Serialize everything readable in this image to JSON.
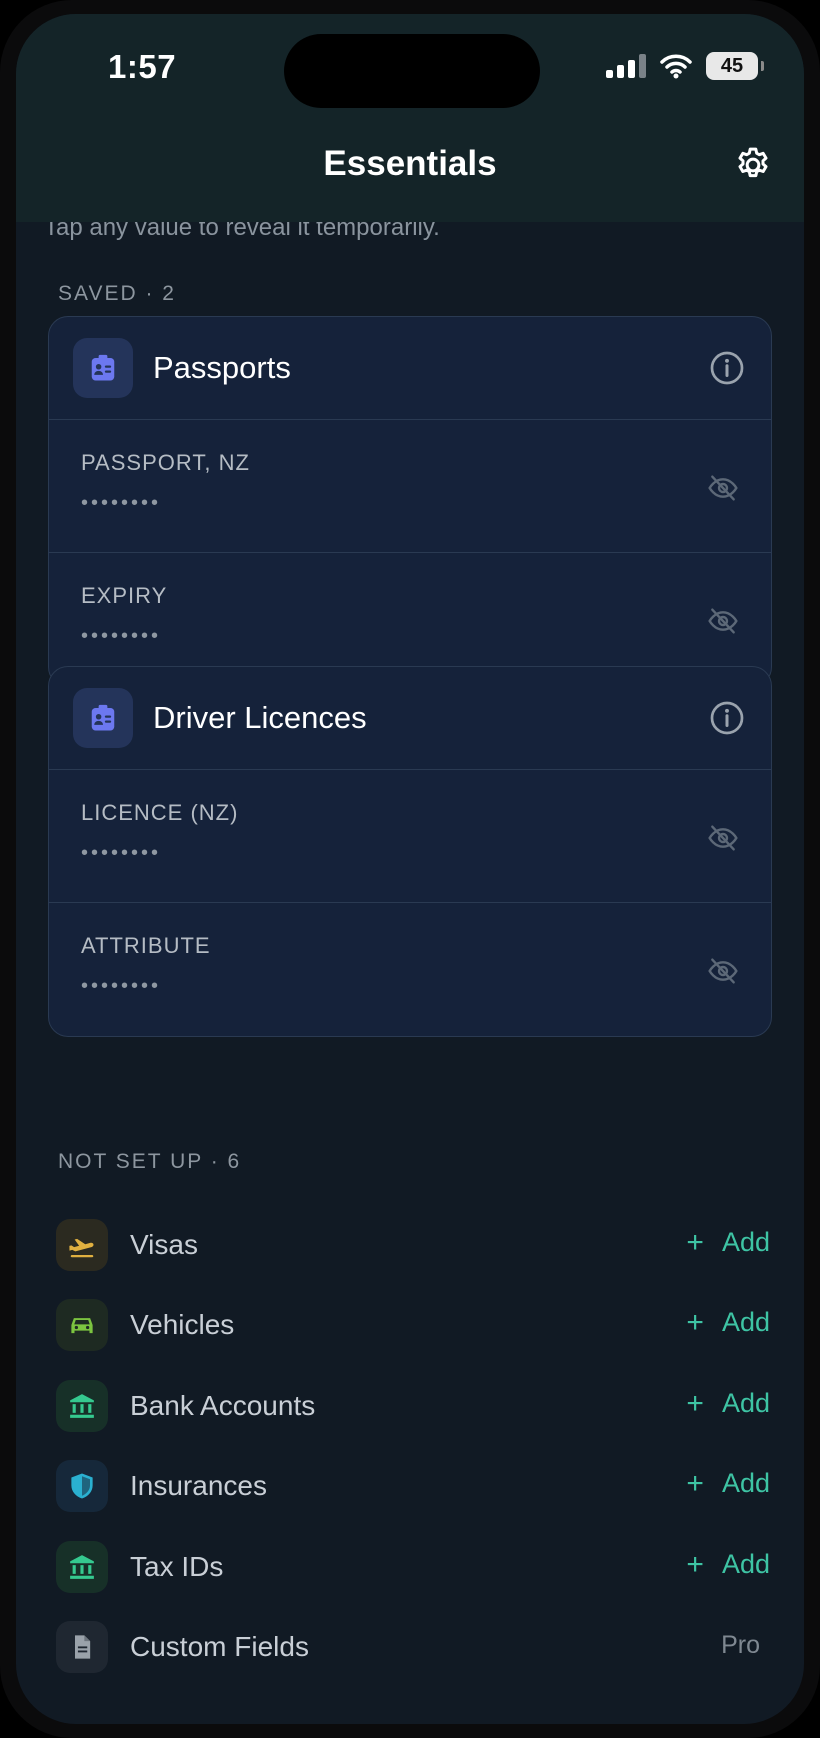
{
  "status_bar": {
    "time": "1:57",
    "battery": "45"
  },
  "header": {
    "title": "Essentials"
  },
  "hint": "Tap any value to reveal it temporarily.",
  "saved_section": {
    "label": "SAVED · 2",
    "cards": [
      {
        "title": "Passports",
        "fields": [
          {
            "label": "PASSPORT, NZ",
            "value": "••••••••"
          },
          {
            "label": "EXPIRY",
            "value": "••••••••"
          }
        ]
      },
      {
        "title": "Driver Licences",
        "fields": [
          {
            "label": "LICENCE (NZ)",
            "value": "••••••••"
          },
          {
            "label": "ATTRIBUTE",
            "value": "••••••••"
          }
        ]
      }
    ]
  },
  "not_setup_section": {
    "label": "NOT SET UP · 6",
    "add_label": "Add",
    "add_symbol": "+",
    "items": [
      {
        "label": "Visas",
        "icon": "plane-departure-icon",
        "color": "#e0b040",
        "bg": "#2b2a20"
      },
      {
        "label": "Vehicles",
        "icon": "car-icon",
        "color": "#7cc440",
        "bg": "#1e2a22"
      },
      {
        "label": "Bank Accounts",
        "icon": "bank-icon",
        "color": "#35c98f",
        "bg": "#173028"
      },
      {
        "label": "Insurances",
        "icon": "shield-icon",
        "color": "#2ab0d0",
        "bg": "#16283a"
      },
      {
        "label": "Tax IDs",
        "icon": "bank-icon",
        "color": "#35c98f",
        "bg": "#173028"
      },
      {
        "label": "Custom Fields",
        "icon": "document-icon",
        "color": "#9aa2aa",
        "bg": "#1f2731",
        "badge": "Pro"
      }
    ]
  },
  "colors": {
    "accent": "#3ec4a4",
    "card_bg": "#15223a",
    "card_icon": "#6c78f0"
  }
}
